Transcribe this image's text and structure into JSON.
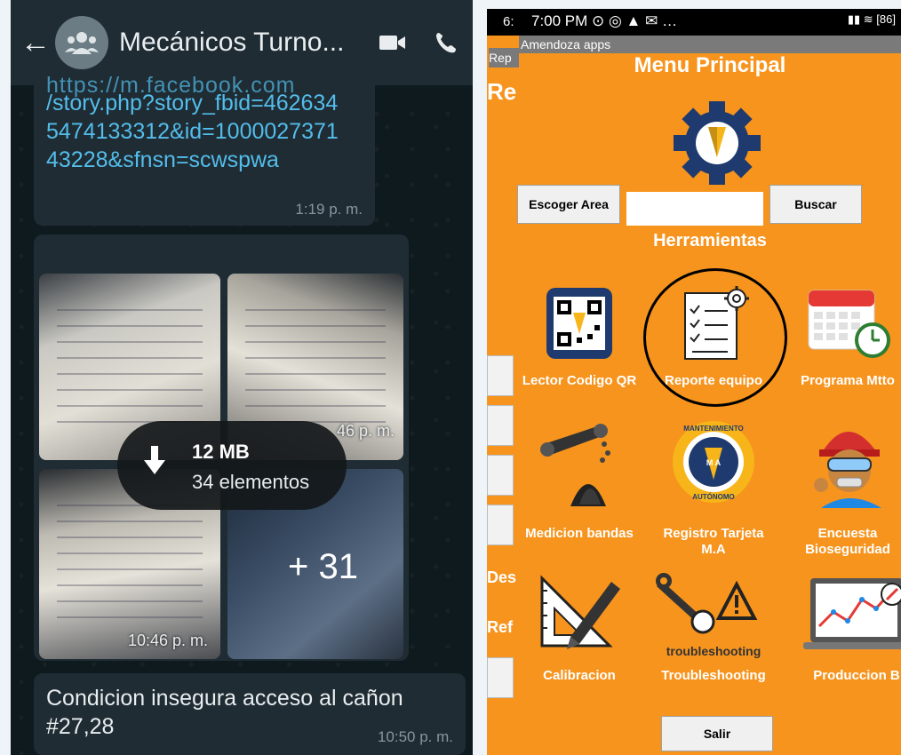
{
  "whatsapp": {
    "back_glyph": "←",
    "chat_title": "Mecánicos Turno...",
    "link_partial": "https://m.facebook.com",
    "link_message": "/story.php?story_fbid=4626345474133312&id=100002737143228&sfnsn=scwspwa",
    "link_time": "1:19 p. m.",
    "photo_time_partial": "46 p. m.",
    "photo_time": "10:46 p. m.",
    "download_size": "12 MB",
    "download_count": "34 elementos",
    "more_count": "+ 31",
    "last_message": "Condicion insegura acceso al cañon #27,28",
    "last_time": "10:50 p. m."
  },
  "phone": {
    "status_time": "7:00 PM",
    "status_extra": "…",
    "status_six": "6:",
    "battery": "86",
    "app_name": "Amendoza apps",
    "behind_rep": "Rep",
    "behind_re": "Re",
    "behind_des": "Des",
    "behind_ref": "Ref",
    "menu_title": "Menu Principal",
    "area_button": "Escoger Area",
    "search_value": "",
    "search_button": "Buscar",
    "tools_heading": "Herramientas",
    "tiles": [
      {
        "label": "Lector Codigo QR",
        "icon": "qr-code-icon"
      },
      {
        "label": "Reporte equipo",
        "icon": "checklist-icon"
      },
      {
        "label": "Programa Mtto",
        "icon": "calendar-icon"
      },
      {
        "label": "Medicion bandas",
        "icon": "conveyor-belt-icon"
      },
      {
        "label": "Registro Tarjeta M.A",
        "icon": "mantenimiento-autonomo-logo"
      },
      {
        "label": "Encuesta Bioseguridad",
        "icon": "worker-icon"
      },
      {
        "label": "Calibracion",
        "icon": "ruler-pencil-icon"
      },
      {
        "label": "Troubleshooting",
        "icon": "troubleshooting-icon"
      },
      {
        "label": "Produccion B",
        "icon": "production-chart-icon"
      }
    ],
    "logo_top_text": "MANTENIMIENTO",
    "logo_bottom_text": "AUTÓNOMO",
    "logo_center": "M A",
    "troubleshooting_caption": "troubleshooting",
    "exit_button": "Salir"
  },
  "colors": {
    "app_orange": "#f7941d",
    "wa_dark": "#0f1a1f",
    "wa_bubble": "#1f2c33",
    "wa_link": "#53bdeb"
  }
}
